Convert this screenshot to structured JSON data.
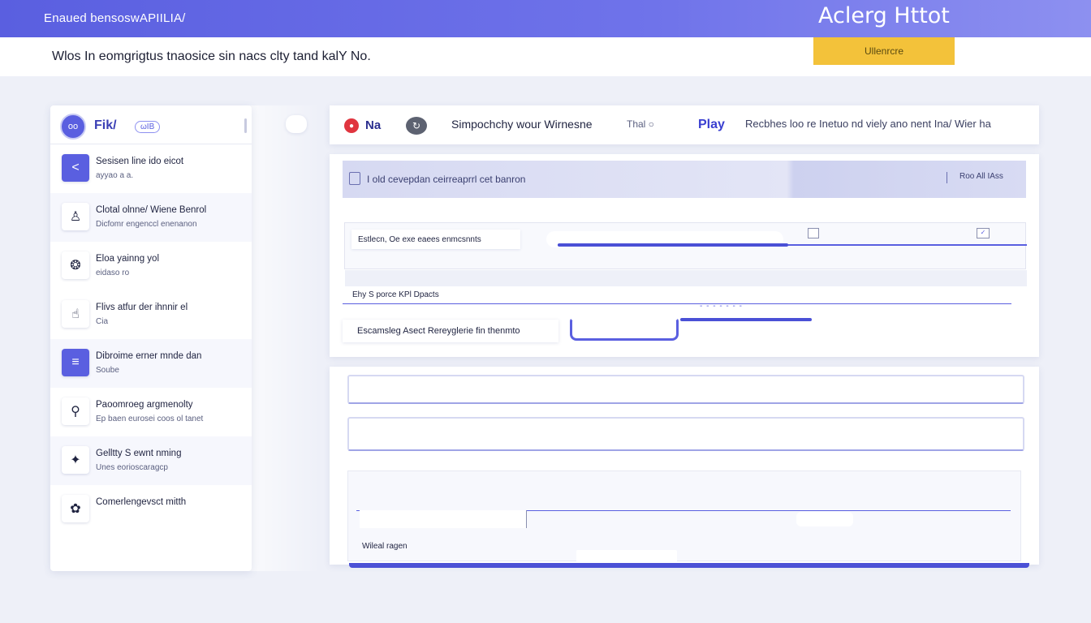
{
  "top_bar": {
    "title": "Enaued bensoswAPIILIA/",
    "brand": "Aclerg Httot"
  },
  "sub_bar": {
    "text": "Wlos In eomgrigtus tnaosice sin nacs clty tand kalY No.",
    "cta_label": "Ullenrcre"
  },
  "colors": {
    "accent": "#5a5fe0",
    "cta": "#f3c23a",
    "danger": "#e0353f"
  },
  "sidebar": {
    "avatar": "oo",
    "brand": "Fik/",
    "badge": "ωIB",
    "items": [
      {
        "icon": "back-arrow-icon",
        "glyph": "<",
        "title": "Sesisen line ido eicot",
        "sub": "ayyao a a."
      },
      {
        "icon": "user-icon",
        "glyph": "♙",
        "title": "Clotal olnne/ Wiene Benrol",
        "sub": "Dicfomr engenccl enenanon"
      },
      {
        "icon": "fingerprint-icon",
        "glyph": "❂",
        "title": "Eloa yainng yol",
        "sub": "eidaso ro"
      },
      {
        "icon": "hand-icon",
        "glyph": "☝",
        "title": "Flivs atfur der ihnnir el",
        "sub": "Cia"
      },
      {
        "icon": "menu-icon",
        "glyph": "≡",
        "title": "Dibroime erner mnde dan",
        "sub": "Soube"
      },
      {
        "icon": "key-icon",
        "glyph": "⚲",
        "title": "Paoomroeg argmenolty",
        "sub": "Ep baen eurosei coos ol tanet"
      },
      {
        "icon": "runner-icon",
        "glyph": "✦",
        "title": "Gelltty S ewnt nming",
        "sub": "Unes eorioscaragcp"
      },
      {
        "icon": "settings-icon",
        "glyph": "✿",
        "title": "Comerlengevsct mitth",
        "sub": ""
      }
    ]
  },
  "main_header": {
    "logo": "Na",
    "title": "Simpochchy wour  Wirnesne",
    "small": "Thal ○",
    "play": "Play",
    "desc": "Recbhes loo re Inetuo nd viely ano nent Ina/ Wier ha"
  },
  "main_card": {
    "banner_text": "I old cevepdan ceirreaprrl cet banron",
    "banner_right": "Roo All IAss",
    "row_label": "Estlecn, Oe exe eaees enmcsnnts",
    "field_label": "Ehy S porce KPl Dpacts",
    "dash": "- - - - - - -",
    "action_label": "Escamsleg Asect Rereyglerie fin thenmto"
  },
  "lower_card": {
    "label": "Wileal ragen"
  }
}
